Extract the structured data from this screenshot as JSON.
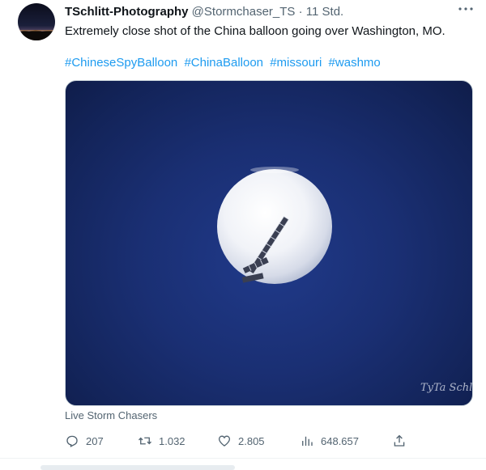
{
  "tweet": {
    "author_name": "TSchlitt-Photography",
    "handle": "@Stormchaser_TS",
    "separator": "·",
    "time": "11 Std.",
    "more_icon": "more-horizontal-icon",
    "text": "Extremely close shot of the China balloon going over Washington, MO.",
    "hashtags": [
      "#ChineseSpyBalloon",
      "#ChinaBalloon",
      "#missouri",
      "#washmo"
    ],
    "media": {
      "watermark": "TyTa Schlitt"
    },
    "caption": "Live Storm Chasers",
    "actions": {
      "replies": {
        "icon": "reply-icon",
        "count": "207"
      },
      "retweets": {
        "icon": "retweet-icon",
        "count": "1.032"
      },
      "likes": {
        "icon": "like-icon",
        "count": "2.805"
      },
      "views": {
        "icon": "views-icon",
        "count": "648.657"
      },
      "share": {
        "icon": "share-icon"
      }
    }
  },
  "colors": {
    "link": "#1d9bf0",
    "secondary_text": "#536471",
    "sky": "#1a2f73"
  }
}
